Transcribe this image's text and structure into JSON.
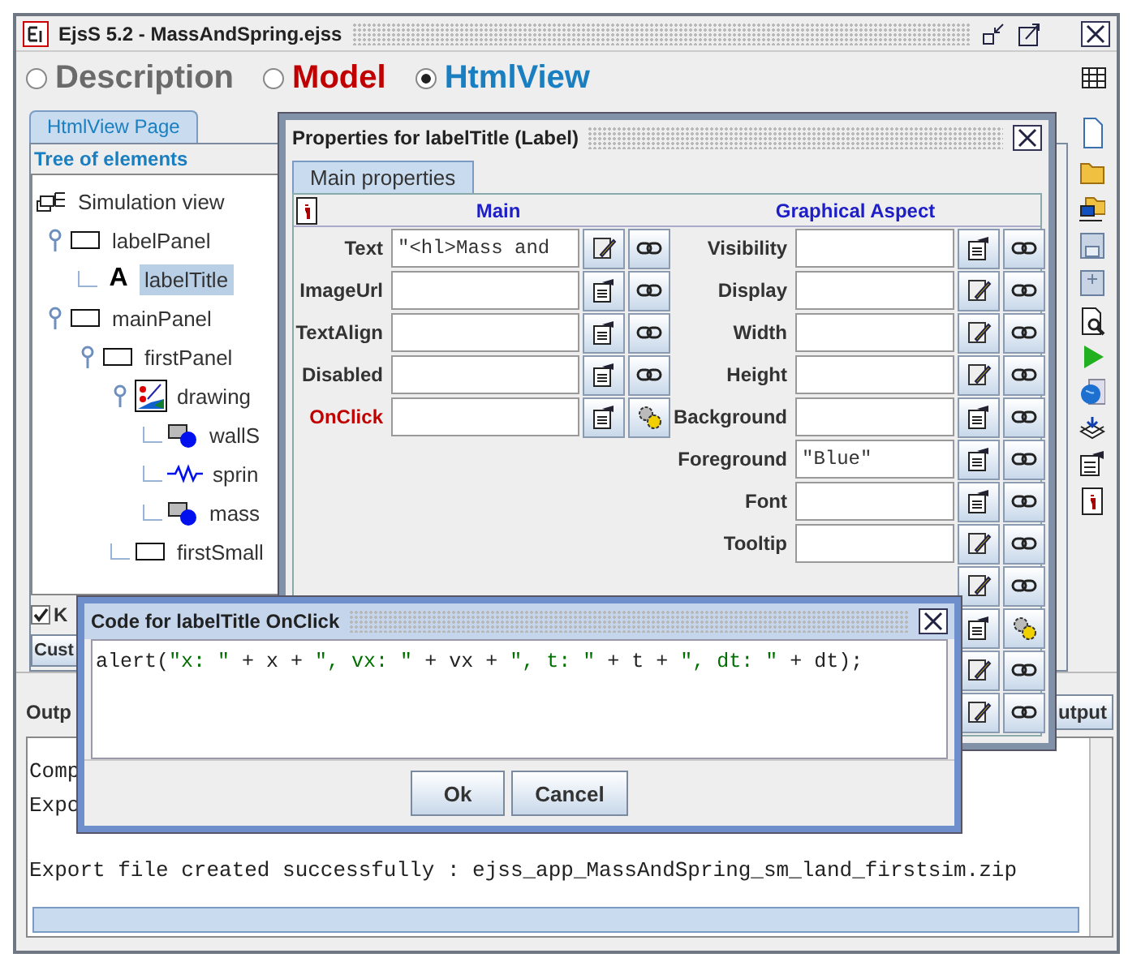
{
  "window": {
    "title": "EjsS 5.2 - MassAndSpring.ejss"
  },
  "modes": [
    {
      "label": "Description",
      "selected": false,
      "color": "#6b6b6b"
    },
    {
      "label": "Model",
      "selected": false,
      "color": "#c00000"
    },
    {
      "label": "HtmlView",
      "selected": true,
      "color": "#1a7fc1"
    }
  ],
  "view_tab": {
    "label": "HtmlView Page"
  },
  "tree": {
    "title": "Tree of elements",
    "items": [
      {
        "label": "Simulation view",
        "kind": "view",
        "selected": false,
        "children": [
          {
            "label": "labelPanel",
            "kind": "panel",
            "selected": false,
            "children": [
              {
                "label": "labelTitle",
                "kind": "label",
                "icon": "A",
                "selected": true
              }
            ]
          },
          {
            "label": "mainPanel",
            "kind": "panel",
            "selected": false,
            "children": [
              {
                "label": "firstPanel",
                "kind": "panel",
                "selected": false,
                "children": [
                  {
                    "label": "drawing",
                    "kind": "drawing",
                    "selected": false,
                    "children": [
                      {
                        "label": "wallS",
                        "kind": "shape",
                        "selected": false
                      },
                      {
                        "label": "sprin",
                        "kind": "spring",
                        "selected": false
                      },
                      {
                        "label": "mass",
                        "kind": "shape",
                        "selected": false
                      }
                    ]
                  },
                  {
                    "label": "firstSmall",
                    "kind": "panel",
                    "selected": false
                  }
                ]
              }
            ]
          }
        ]
      }
    ]
  },
  "options": {
    "checkbox": {
      "label": "K",
      "checked": true
    },
    "button": "Cust"
  },
  "output": {
    "title": "Outp",
    "button": "utput",
    "lines": [
      "Comp",
      "Expo",
      "Export file created successfully : ejss_app_MassAndSpring_sm_land_firstsim.zip"
    ]
  },
  "properties_dialog": {
    "title": "Properties for labelTitle (Label)",
    "tab": "Main properties",
    "main_heading": "Main",
    "graphical_heading": "Graphical Aspect",
    "main_rows": [
      {
        "label": "Text",
        "value": "\"<hl>Mass and",
        "buttons": [
          {
            "kind": "edit"
          },
          {
            "kind": "link"
          }
        ],
        "highlighted": false
      },
      {
        "label": "ImageUrl",
        "buttons": [
          {
            "kind": "props"
          },
          {
            "kind": "link"
          }
        ],
        "highlighted": false
      },
      {
        "label": "TextAlign",
        "buttons": [
          {
            "kind": "props"
          },
          {
            "kind": "link"
          }
        ],
        "highlighted": false
      },
      {
        "label": "Disabled",
        "buttons": [
          {
            "kind": "props"
          },
          {
            "kind": "link"
          }
        ],
        "highlighted": false
      },
      {
        "label": "OnClick",
        "buttons": [
          {
            "kind": "props"
          },
          {
            "kind": "gear"
          }
        ],
        "highlighted": true
      }
    ],
    "graphical_rows": [
      {
        "label": "Visibility",
        "buttons": [
          {
            "kind": "props"
          },
          {
            "kind": "link"
          }
        ]
      },
      {
        "label": "Display",
        "buttons": [
          {
            "kind": "edit"
          },
          {
            "kind": "link"
          }
        ]
      },
      {
        "label": "Width",
        "buttons": [
          {
            "kind": "edit"
          },
          {
            "kind": "link"
          }
        ]
      },
      {
        "label": "Height",
        "buttons": [
          {
            "kind": "edit"
          },
          {
            "kind": "link"
          }
        ]
      },
      {
        "label": "Background",
        "buttons": [
          {
            "kind": "props"
          },
          {
            "kind": "link"
          }
        ]
      },
      {
        "label": "Foreground",
        "value": "\"Blue\"",
        "buttons": [
          {
            "kind": "props"
          },
          {
            "kind": "link"
          }
        ]
      },
      {
        "label": "Font",
        "buttons": [
          {
            "kind": "props"
          },
          {
            "kind": "link"
          }
        ]
      },
      {
        "label": "Tooltip",
        "buttons": [
          {
            "kind": "edit"
          },
          {
            "kind": "link"
          }
        ]
      },
      {
        "buttons": [
          {
            "kind": "edit"
          },
          {
            "kind": "link"
          }
        ]
      },
      {
        "buttons": [
          {
            "kind": "props"
          },
          {
            "kind": "gear"
          }
        ]
      },
      {
        "buttons": [
          {
            "kind": "edit"
          },
          {
            "kind": "link"
          }
        ]
      },
      {
        "buttons": [
          {
            "kind": "edit"
          },
          {
            "kind": "link"
          }
        ]
      }
    ]
  },
  "code_dialog": {
    "title": "Code for labelTitle OnClick",
    "code": [
      {
        "text": "alert(",
        "kind": "code"
      },
      {
        "text": "\"x: \"",
        "kind": "string"
      },
      {
        "text": " + x + ",
        "kind": "code"
      },
      {
        "text": "\", vx: \"",
        "kind": "string"
      },
      {
        "text": " + vx + ",
        "kind": "code"
      },
      {
        "text": "\", t: \"",
        "kind": "string"
      },
      {
        "text": " + t + ",
        "kind": "code"
      },
      {
        "text": "\", dt: \"",
        "kind": "string"
      },
      {
        "text": " + dt);",
        "kind": "code"
      }
    ],
    "buttons": [
      "Ok",
      "Cancel"
    ]
  }
}
